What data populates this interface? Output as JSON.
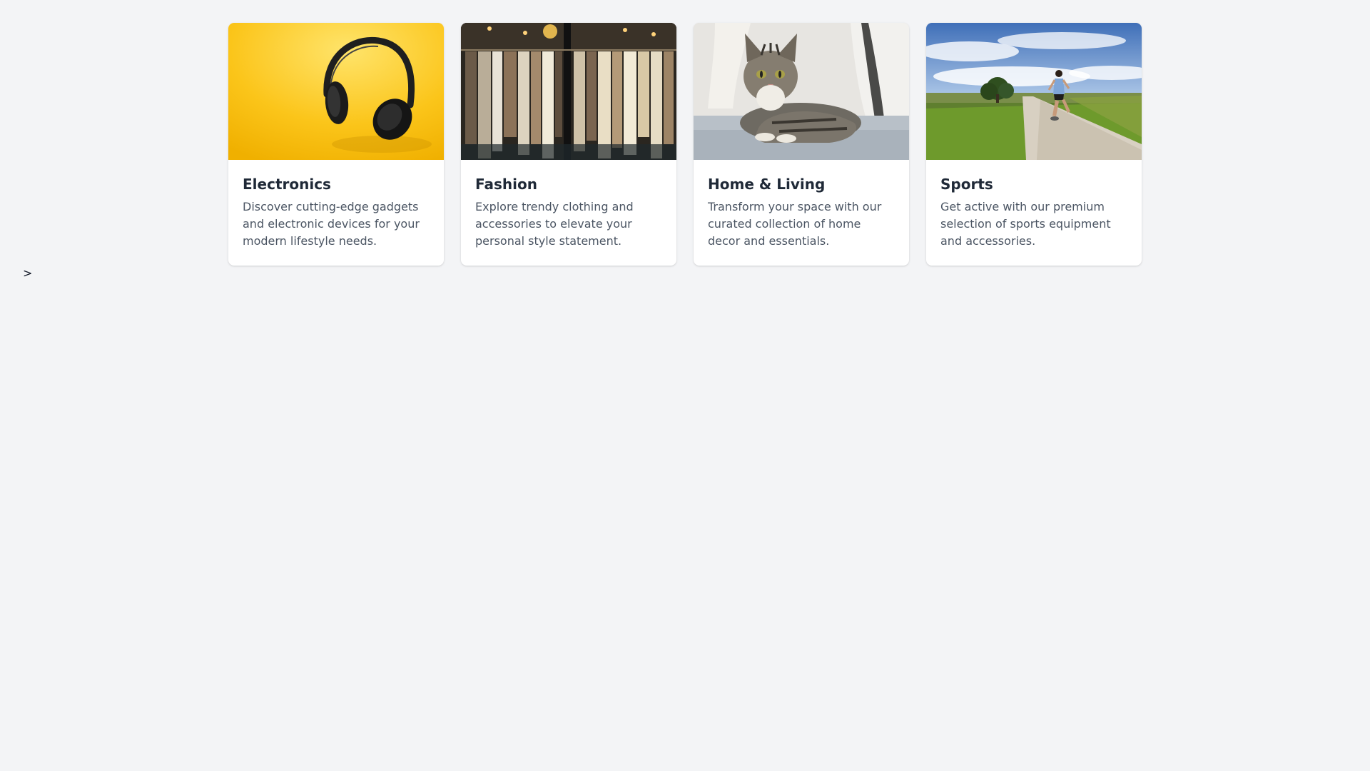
{
  "stray_text": ">",
  "categories": [
    {
      "title": "Electronics",
      "description": "Discover cutting-edge gadgets and electronic devices for your modern lifestyle needs.",
      "image": "headphones-photo"
    },
    {
      "title": "Fashion",
      "description": "Explore trendy clothing and accessories to elevate your personal style statement.",
      "image": "clothing-rack-photo"
    },
    {
      "title": "Home & Living",
      "description": "Transform your space with our curated collection of home decor and essentials.",
      "image": "cat-on-sofa-photo"
    },
    {
      "title": "Sports",
      "description": "Get active with our premium selection of sports equipment and accessories.",
      "image": "runner-on-path-photo"
    }
  ],
  "colors": {
    "page_background": "#f3f4f6",
    "card_background": "#ffffff",
    "title": "#1f2937",
    "description": "#4b5563"
  }
}
